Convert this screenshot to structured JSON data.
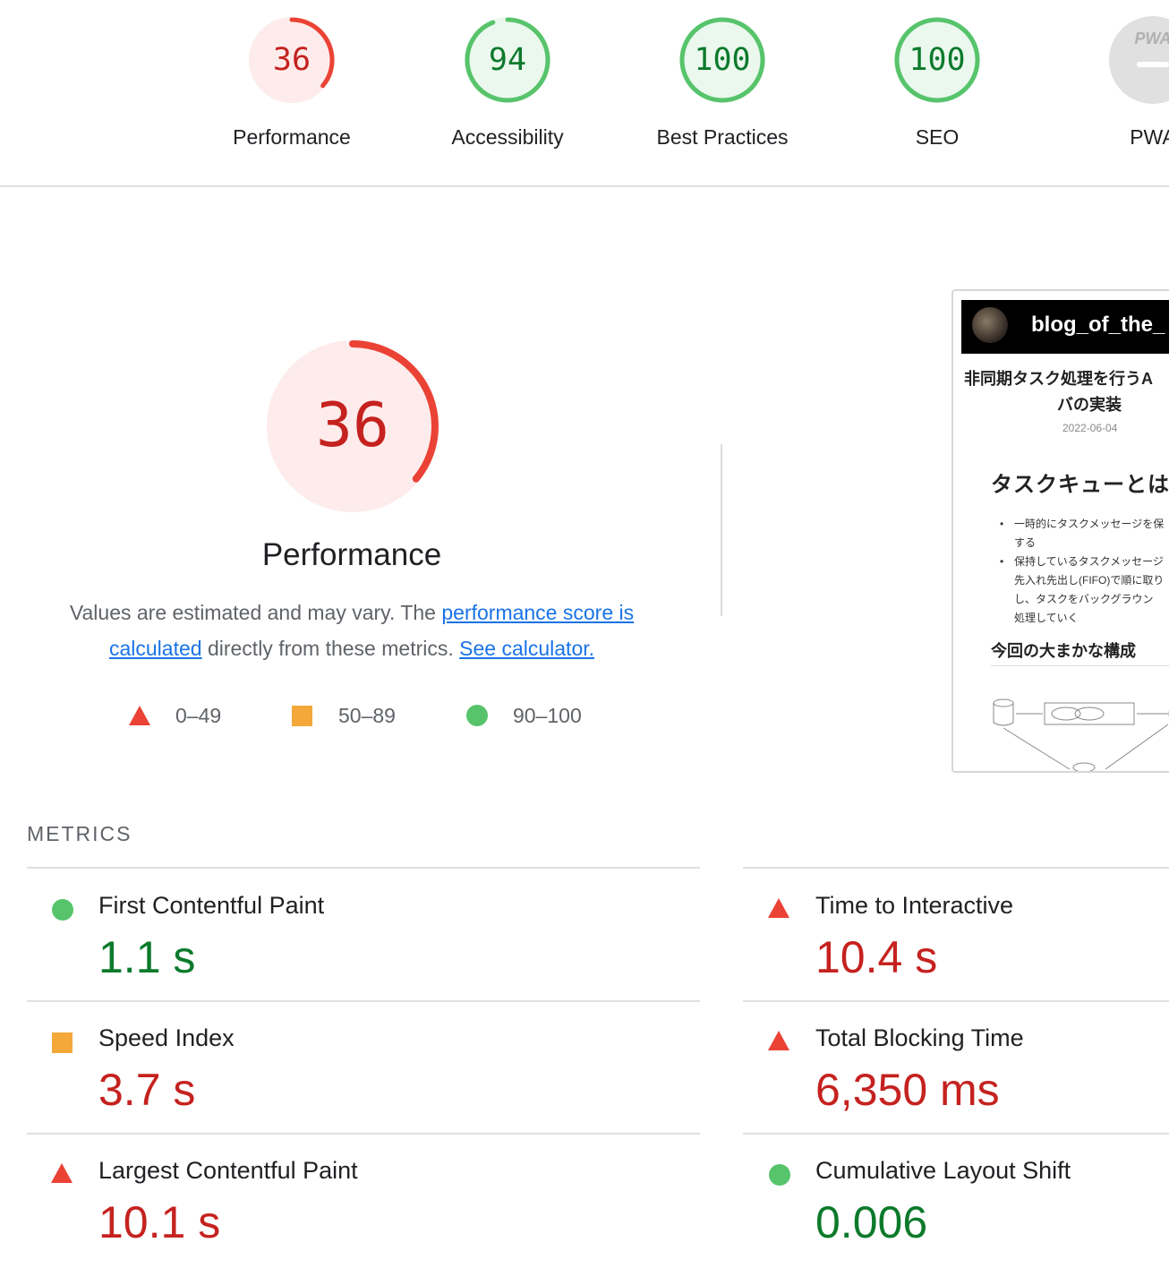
{
  "gauges": [
    {
      "score": "36",
      "label": "Performance",
      "status": "bad",
      "fraction": 0.36
    },
    {
      "score": "94",
      "label": "Accessibility",
      "status": "good",
      "fraction": 0.94
    },
    {
      "score": "100",
      "label": "Best Practices",
      "status": "good",
      "fraction": 1.0
    },
    {
      "score": "100",
      "label": "SEO",
      "status": "good",
      "fraction": 1.0
    },
    {
      "score": "PWA",
      "label": "PWA",
      "status": "na",
      "fraction": 0
    }
  ],
  "performance": {
    "score": "36",
    "fraction": 0.36,
    "title": "Performance",
    "desc_part1": "Values are estimated and may vary. The ",
    "link1": "performance score is calculated",
    "desc_part2": " directly from these metrics. ",
    "link2": "See calculator."
  },
  "legend": [
    {
      "shape": "triangle",
      "range": "0–49"
    },
    {
      "shape": "square",
      "range": "50–89"
    },
    {
      "shape": "circle",
      "range": "90–100"
    }
  ],
  "thumbnail": {
    "brand": "blog_of_the_",
    "title_line1": "非同期タスク処理を行うA",
    "title_line2": "バの実装",
    "date": "2022-06-04",
    "heading": "タスクキューとは",
    "list": [
      [
        "一時的にタスクメッセージを保",
        "する"
      ],
      [
        "保持しているタスクメッセージ",
        "先入れ先出し(FIFO)で順に取り",
        "し、タスクをバックグラウン",
        "処理していく"
      ]
    ],
    "subheading": "今回の大まかな構成"
  },
  "metrics_heading": "METRICS",
  "metrics": [
    {
      "label": "First Contentful Paint",
      "value": "1.1 s",
      "status": "good"
    },
    {
      "label": "Time to Interactive",
      "value": "10.4 s",
      "status": "bad"
    },
    {
      "label": "Speed Index",
      "value": "3.7 s",
      "status": "average"
    },
    {
      "label": "Total Blocking Time",
      "value": "6,350 ms",
      "status": "bad"
    },
    {
      "label": "Largest Contentful Paint",
      "value": "10.1 s",
      "status": "bad"
    },
    {
      "label": "Cumulative Layout Shift",
      "value": "0.006",
      "status": "good"
    }
  ],
  "colors": {
    "bad": "#c5221f",
    "bad_arc": "#eb4236",
    "bad_bg": "#fdeceb",
    "good": "#0c7a2b",
    "good_arc": "#57c46b",
    "good_bg": "#ebf8ee",
    "average": "#f4a83a",
    "link": "#1a73e8"
  }
}
